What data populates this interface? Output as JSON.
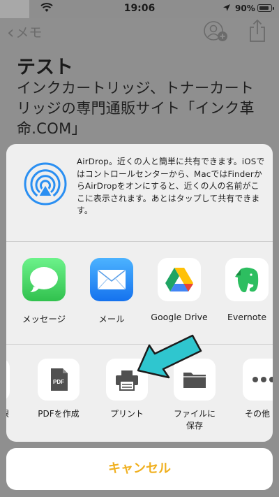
{
  "status_bar": {
    "time": "19:06",
    "battery_text": "90%",
    "battery_level": 0.9
  },
  "nav": {
    "back_label": "メモ"
  },
  "note": {
    "title": "テスト",
    "body": "インクカートリッジ、トナーカートリッジの専門通販サイト「インク革命.COM」"
  },
  "airdrop": {
    "description": "AirDrop。近くの人と簡単に共有できます。iOSではコントロールセンターから、MacではFinderからAirDropをオンにすると、近くの人の名前がここに表示されます。あとはタップして共有できます。"
  },
  "apps": [
    {
      "label": "メッセージ",
      "icon": "messages-icon"
    },
    {
      "label": "メール",
      "icon": "mail-icon"
    },
    {
      "label": "Google Drive",
      "icon": "google-drive-icon"
    },
    {
      "label": "Evernote",
      "icon": "evernote-icon"
    }
  ],
  "actions": [
    {
      "label": "眼",
      "icon": "partial-action-icon"
    },
    {
      "label": "PDFを作成",
      "icon": "pdf-icon",
      "badge": "PDF"
    },
    {
      "label": "プリント",
      "icon": "printer-icon"
    },
    {
      "label": "ファイルに\n保存",
      "icon": "folder-icon"
    },
    {
      "label": "その他",
      "icon": "more-icon"
    }
  ],
  "cancel_label": "キャンセル",
  "colors": {
    "cancel": "#f0b020",
    "airdrop": "#2a8ff2",
    "arrow": "#2fc6cf"
  }
}
